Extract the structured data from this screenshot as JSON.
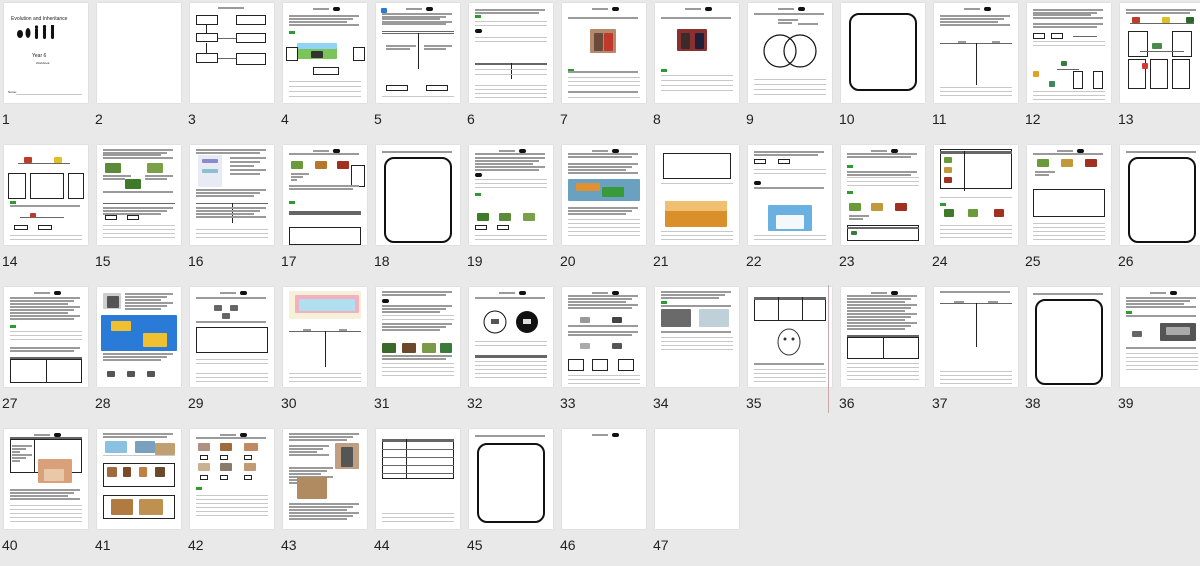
{
  "document": {
    "cover_title": "Evolution and Inheritance",
    "cover_year": "Year 6",
    "cover_subtitle": "Workbook",
    "cover_name_label": "Name:"
  },
  "pages": [
    "1",
    "2",
    "3",
    "4",
    "5",
    "6",
    "7",
    "8",
    "9",
    "10",
    "11",
    "12",
    "13",
    "14",
    "15",
    "16",
    "17",
    "18",
    "19",
    "20",
    "21",
    "22",
    "23",
    "24",
    "25",
    "26",
    "27",
    "28",
    "29",
    "30",
    "31",
    "32",
    "33",
    "34",
    "35",
    "36",
    "37",
    "38",
    "39",
    "40",
    "41",
    "42",
    "43",
    "44",
    "45",
    "46",
    "47"
  ],
  "colors": {
    "background": "#e9e9e9",
    "page": "#ffffff",
    "badge": "#2e9b2e",
    "section_divider": "#c9a9a9"
  }
}
